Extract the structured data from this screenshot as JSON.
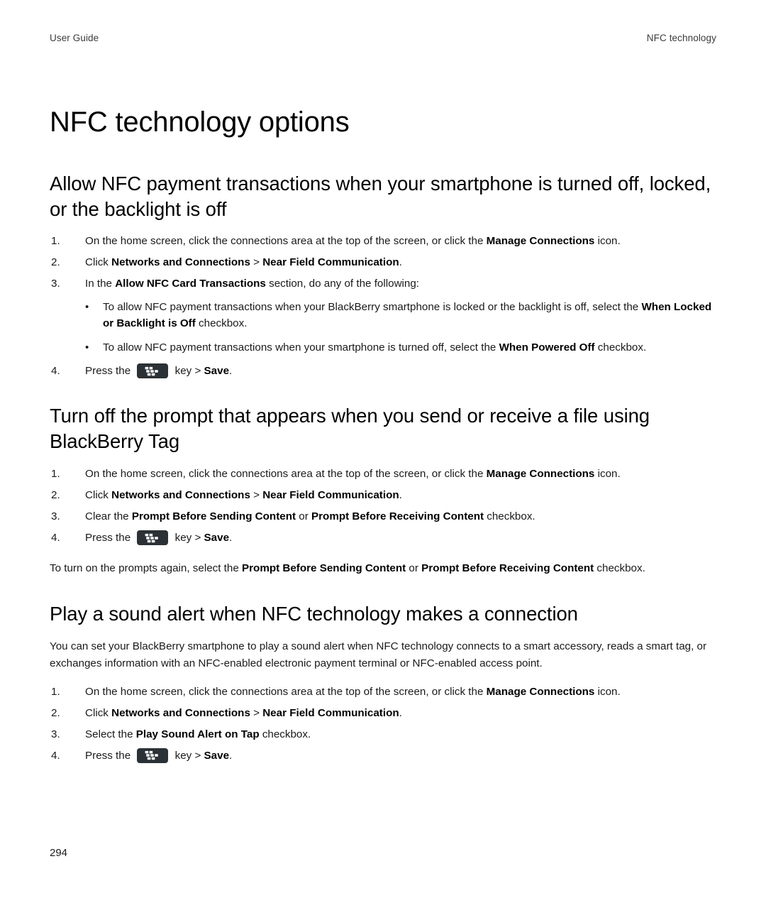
{
  "header": {
    "left": "User Guide",
    "right": "NFC technology"
  },
  "doc_title": "NFC technology options",
  "icons": {
    "blackberry_menu_key": "blackberry-menu-key-icon"
  },
  "sections": [
    {
      "heading": "Allow NFC payment transactions when your smartphone is turned off, locked, or the backlight is off",
      "steps": [
        {
          "marker": "1.",
          "parts": [
            {
              "t": "On the home screen, click the connections area at the top of the screen, or click the ",
              "b": false
            },
            {
              "t": "Manage Connections",
              "b": true
            },
            {
              "t": " icon.",
              "b": false
            }
          ]
        },
        {
          "marker": "2.",
          "parts": [
            {
              "t": "Click ",
              "b": false
            },
            {
              "t": "Networks and Connections",
              "b": true
            },
            {
              "t": " > ",
              "b": false
            },
            {
              "t": "Near Field Communication",
              "b": true
            },
            {
              "t": ".",
              "b": false
            }
          ]
        },
        {
          "marker": "3.",
          "parts": [
            {
              "t": "In the ",
              "b": false
            },
            {
              "t": "Allow NFC Card Transactions",
              "b": true
            },
            {
              "t": " section, do any of the following:",
              "b": false
            }
          ],
          "bullets": [
            {
              "dot": "•",
              "parts": [
                {
                  "t": "To allow NFC payment transactions when your BlackBerry smartphone is locked or the backlight is off, select the ",
                  "b": false
                },
                {
                  "t": "When Locked or Backlight is Off",
                  "b": true
                },
                {
                  "t": " checkbox.",
                  "b": false
                }
              ]
            },
            {
              "dot": "•",
              "parts": [
                {
                  "t": "To allow NFC payment transactions when your smartphone is turned off, select the ",
                  "b": false
                },
                {
                  "t": "When Powered Off",
                  "b": true
                },
                {
                  "t": " checkbox.",
                  "b": false
                }
              ]
            }
          ]
        },
        {
          "marker": "4.",
          "parts": [
            {
              "t": "Press the ",
              "b": false
            },
            {
              "icon": "blackberry-menu-key-icon"
            },
            {
              "t": " key > ",
              "b": false
            },
            {
              "t": "Save",
              "b": true
            },
            {
              "t": ".",
              "b": false
            }
          ]
        }
      ]
    },
    {
      "heading": "Turn off the prompt that appears when you send or receive a file using BlackBerry Tag",
      "steps": [
        {
          "marker": "1.",
          "parts": [
            {
              "t": "On the home screen, click the connections area at the top of the screen, or click the ",
              "b": false
            },
            {
              "t": "Manage Connections",
              "b": true
            },
            {
              "t": " icon.",
              "b": false
            }
          ]
        },
        {
          "marker": "2.",
          "parts": [
            {
              "t": "Click ",
              "b": false
            },
            {
              "t": "Networks and Connections",
              "b": true
            },
            {
              "t": " > ",
              "b": false
            },
            {
              "t": "Near Field Communication",
              "b": true
            },
            {
              "t": ".",
              "b": false
            }
          ]
        },
        {
          "marker": "3.",
          "parts": [
            {
              "t": "Clear the ",
              "b": false
            },
            {
              "t": "Prompt Before Sending Content",
              "b": true
            },
            {
              "t": " or ",
              "b": false
            },
            {
              "t": "Prompt Before Receiving Content",
              "b": true
            },
            {
              "t": " checkbox.",
              "b": false
            }
          ]
        },
        {
          "marker": "4.",
          "parts": [
            {
              "t": "Press the ",
              "b": false
            },
            {
              "icon": "blackberry-menu-key-icon"
            },
            {
              "t": " key > ",
              "b": false
            },
            {
              "t": "Save",
              "b": true
            },
            {
              "t": ".",
              "b": false
            }
          ]
        }
      ],
      "after_note": [
        {
          "t": "To turn on the prompts again, select the ",
          "b": false
        },
        {
          "t": "Prompt Before Sending Content",
          "b": true
        },
        {
          "t": " or ",
          "b": false
        },
        {
          "t": "Prompt Before Receiving Content",
          "b": true
        },
        {
          "t": " checkbox.",
          "b": false
        }
      ]
    },
    {
      "heading": "Play a sound alert when NFC technology makes a connection",
      "intro": [
        {
          "t": "You can set your BlackBerry smartphone to play a sound alert when NFC technology connects to a smart accessory, reads a smart tag, or exchanges information with an NFC-enabled electronic payment terminal or NFC-enabled access point.",
          "b": false
        }
      ],
      "steps": [
        {
          "marker": "1.",
          "parts": [
            {
              "t": "On the home screen, click the connections area at the top of the screen, or click the ",
              "b": false
            },
            {
              "t": "Manage Connections",
              "b": true
            },
            {
              "t": " icon.",
              "b": false
            }
          ]
        },
        {
          "marker": "2.",
          "parts": [
            {
              "t": "Click ",
              "b": false
            },
            {
              "t": "Networks and Connections",
              "b": true
            },
            {
              "t": " > ",
              "b": false
            },
            {
              "t": "Near Field Communication",
              "b": true
            },
            {
              "t": ".",
              "b": false
            }
          ]
        },
        {
          "marker": "3.",
          "parts": [
            {
              "t": "Select the ",
              "b": false
            },
            {
              "t": "Play Sound Alert on Tap",
              "b": true
            },
            {
              "t": " checkbox.",
              "b": false
            }
          ]
        },
        {
          "marker": "4.",
          "parts": [
            {
              "t": "Press the ",
              "b": false
            },
            {
              "icon": "blackberry-menu-key-icon"
            },
            {
              "t": " key > ",
              "b": false
            },
            {
              "t": "Save",
              "b": true
            },
            {
              "t": ".",
              "b": false
            }
          ]
        }
      ]
    }
  ],
  "page_number": "294"
}
